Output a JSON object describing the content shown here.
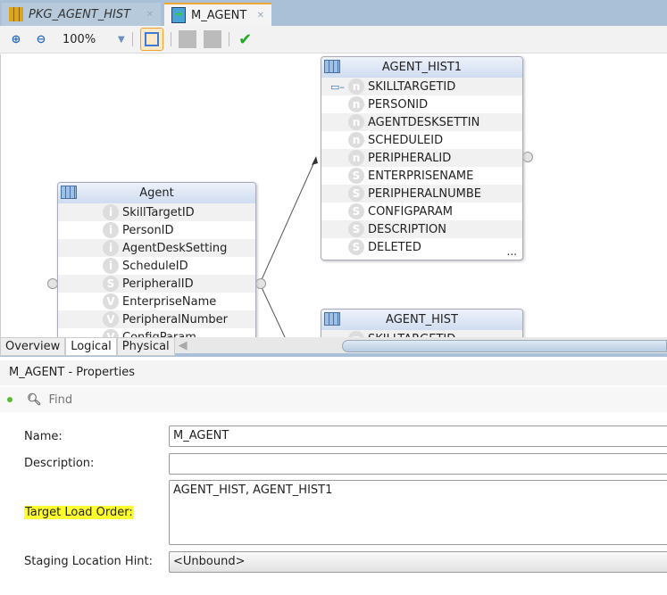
{
  "tabs": [
    {
      "label": "PKG_AGENT_HIST",
      "icon": "package-icon"
    },
    {
      "label": "M_AGENT",
      "icon": "mapping-icon"
    }
  ],
  "toolbar": {
    "zoom": "100%"
  },
  "entities": {
    "agent": {
      "title": "Agent",
      "columns": [
        {
          "name": "SkillTargetID",
          "type": "i"
        },
        {
          "name": "PersonID",
          "type": "i"
        },
        {
          "name": "AgentDeskSetting",
          "type": "i"
        },
        {
          "name": "ScheduleID",
          "type": "i"
        },
        {
          "name": "PeripheralID",
          "type": "S"
        },
        {
          "name": "EnterpriseName",
          "type": "V"
        },
        {
          "name": "PeripheralNumber",
          "type": "V"
        },
        {
          "name": "ConfigParam",
          "type": "V"
        }
      ]
    },
    "agent_hist1": {
      "title": "AGENT_HIST1",
      "columns": [
        {
          "name": "SKILLTARGETID",
          "type": "n"
        },
        {
          "name": "PERSONID",
          "type": "n"
        },
        {
          "name": "AGENTDESKSETTIN",
          "type": "n"
        },
        {
          "name": "SCHEDULEID",
          "type": "n"
        },
        {
          "name": "PERIPHERALID",
          "type": "n"
        },
        {
          "name": "ENTERPRISENAME",
          "type": "S"
        },
        {
          "name": "PERIPHERALNUMBE",
          "type": "S"
        },
        {
          "name": "CONFIGPARAM",
          "type": "S"
        },
        {
          "name": "DESCRIPTION",
          "type": "S"
        },
        {
          "name": "DELETED",
          "type": "S"
        }
      ],
      "more": "..."
    },
    "agent_hist": {
      "title": "AGENT_HIST",
      "columns": [
        {
          "name": "SKILLTARGETID",
          "type": "n"
        }
      ]
    }
  },
  "view_tabs": [
    "Overview",
    "Logical",
    "Physical"
  ],
  "properties": {
    "title": "M_AGENT - Properties",
    "find_placeholder": "Find",
    "name_label": "Name:",
    "name_value": "M_AGENT",
    "description_label": "Description:",
    "description_value": "",
    "tlo_label": "Target Load Order:",
    "tlo_value": "AGENT_HIST, AGENT_HIST1",
    "staging_label": "Staging Location Hint:",
    "staging_value": "<Unbound>"
  }
}
